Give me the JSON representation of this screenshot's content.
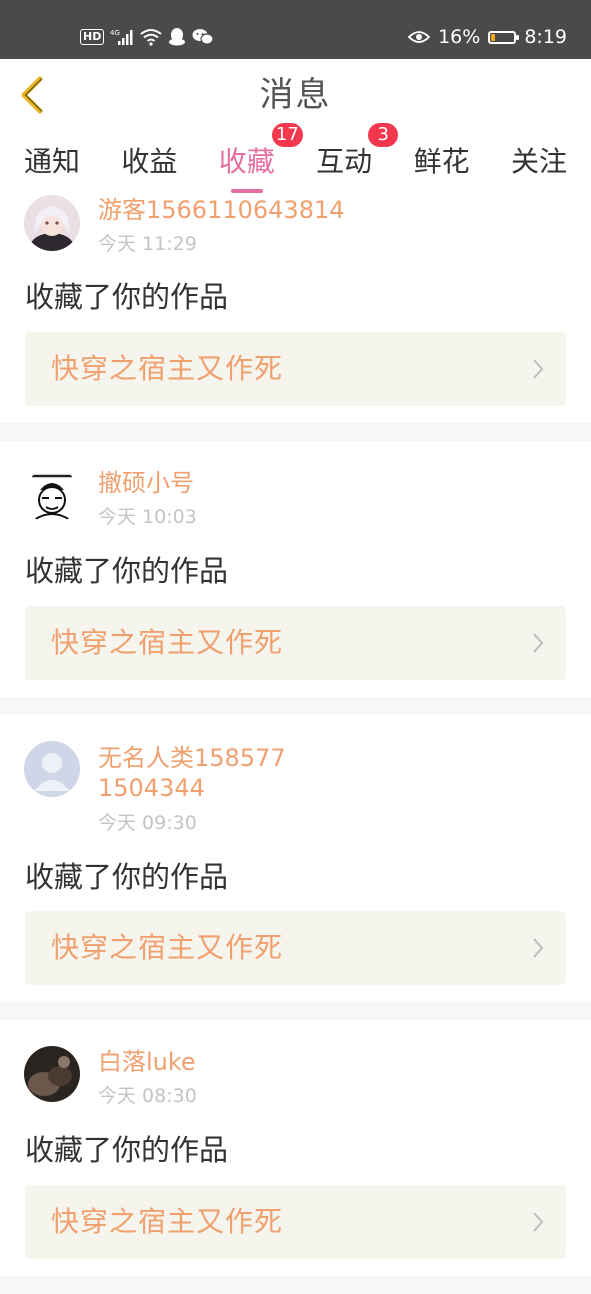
{
  "status_bar": {
    "left_icons": [
      "hd-icon",
      "4g-signal-icon",
      "wifi-icon",
      "qq-icon",
      "wechat-icon"
    ],
    "hd_label": "HD",
    "net_label": "4G",
    "battery_percent": "16%",
    "battery_level": 0.16,
    "time": "8:19"
  },
  "header": {
    "title": "消息"
  },
  "tabs": [
    {
      "label": "通知",
      "badge": ""
    },
    {
      "label": "收益",
      "badge": ""
    },
    {
      "label": "收藏",
      "badge": "17",
      "active": true
    },
    {
      "label": "互动",
      "badge": "3"
    },
    {
      "label": "鲜花",
      "badge": ""
    },
    {
      "label": "关注",
      "badge": ""
    }
  ],
  "messages": [
    {
      "username": "游客1566110643814",
      "time": "今天 11:29",
      "action": "收藏了你的作品",
      "work_title": "快穿之宿主又作死"
    },
    {
      "username": "撤硕小号",
      "time": "今天 10:03",
      "action": "收藏了你的作品",
      "work_title": "快穿之宿主又作死"
    },
    {
      "username": "无名人类1585771504344",
      "time": "今天 09:30",
      "action": "收藏了你的作品",
      "work_title": "快穿之宿主又作死"
    },
    {
      "username": "白落luke",
      "time": "今天 08:30",
      "action": "收藏了你的作品",
      "work_title": "快穿之宿主又作死"
    }
  ],
  "colors": {
    "accent_pink": "#e66fa0",
    "username_orange": "#f0a06e",
    "badge_red": "#f2374e",
    "status_bar_bg": "#4a4a4a",
    "work_box_bg": "#f5f5ee"
  }
}
